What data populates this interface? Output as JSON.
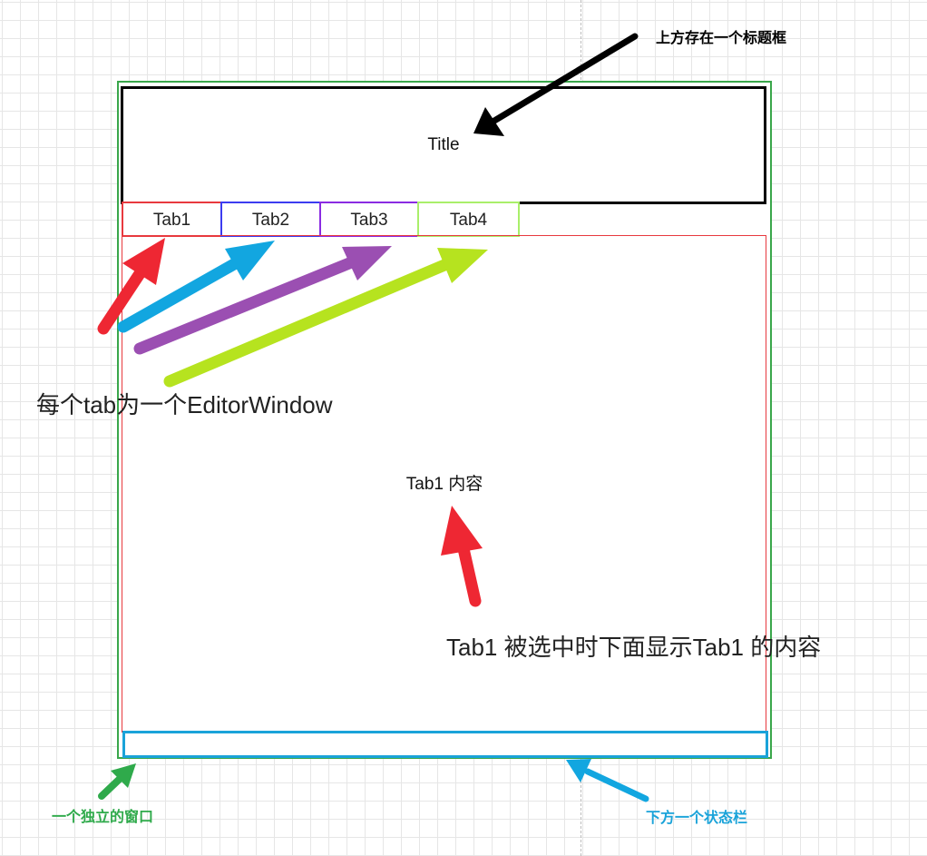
{
  "window": {
    "title": "Title",
    "tabs": [
      {
        "label": "Tab1",
        "color": "#e8393e"
      },
      {
        "label": "Tab2",
        "color": "#3c3cf0"
      },
      {
        "label": "Tab3",
        "color": "#8a2be2"
      },
      {
        "label": "Tab4",
        "color": "#a9ef6a"
      }
    ],
    "content_text": "Tab1 内容",
    "status_bar_text": ""
  },
  "annotations": {
    "title_note": "上方存在一个标题框",
    "tabs_note": "每个tab为一个EditorWindow",
    "selection_note": "Tab1 被选中时下面显示Tab1 的内容",
    "window_note": "一个独立的窗口",
    "status_note": "下方一个状态栏"
  },
  "colors": {
    "window_border": "#3aa74b",
    "title_border": "#000000",
    "content_border": "#e8393e",
    "status_border": "#1aa3d9",
    "arrow_black": "#000000",
    "arrow_red": "#ee2733",
    "arrow_blue": "#12a6e0",
    "arrow_purple": "#9b4fb2",
    "arrow_lime": "#b6e31f",
    "arrow_green": "#2faa4b"
  }
}
